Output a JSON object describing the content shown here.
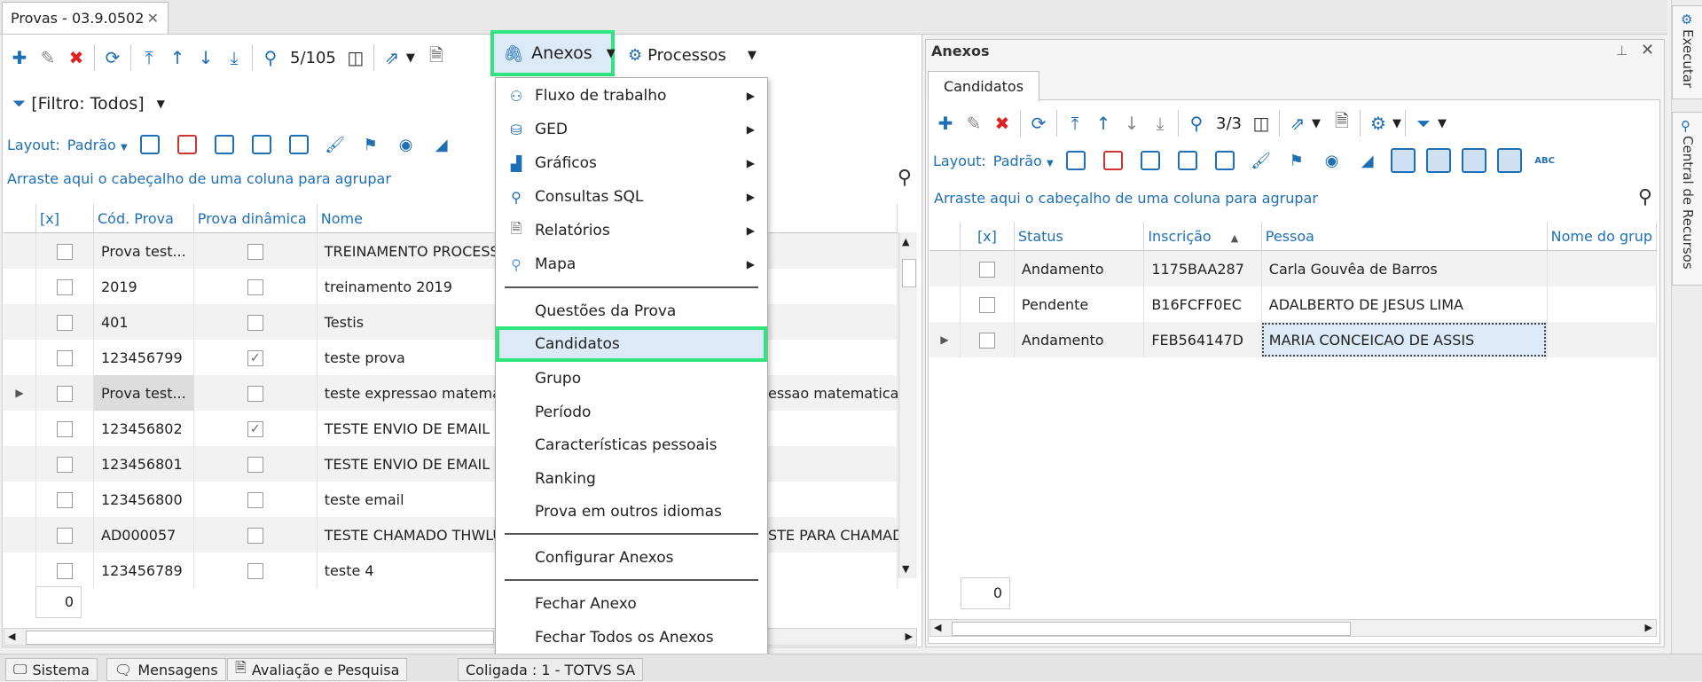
{
  "window": {
    "tab_title": "Provas - 03.9.0502",
    "tab_close": "✕"
  },
  "toolbar": {
    "counter": "5/105",
    "anexos_label": "Anexos",
    "processos_label": "Processos"
  },
  "filter": {
    "label": "[Filtro: Todos]"
  },
  "layoutbar": {
    "label": "Layout:",
    "value": "Padrão"
  },
  "grid": {
    "group_hint": "Arraste aqui o cabeçalho de uma coluna para agrupar",
    "columns": [
      "[x]",
      "Cód. Prova",
      "Prova dinâmica",
      "Nome"
    ],
    "rows": [
      {
        "cod": "Prova test...",
        "dyn": false,
        "nome": "TREINAMENTO PROCESSO",
        "extra": ""
      },
      {
        "cod": "2019",
        "dyn": false,
        "nome": "treinamento 2019",
        "extra": ""
      },
      {
        "cod": "401",
        "dyn": false,
        "nome": "Testis",
        "extra": ""
      },
      {
        "cod": "123456799",
        "dyn": true,
        "nome": "teste prova",
        "extra": ""
      },
      {
        "cod": "Prova test...",
        "dyn": false,
        "nome": "teste expressao matematica",
        "extra": "essao matematica"
      },
      {
        "cod": "123456802",
        "dyn": true,
        "nome": "TESTE ENVIO DE EMAIL WE",
        "extra": ""
      },
      {
        "cod": "123456801",
        "dyn": false,
        "nome": "TESTE ENVIO DE EMAIL WE",
        "extra": ""
      },
      {
        "cod": "123456800",
        "dyn": false,
        "nome": "teste email",
        "extra": ""
      },
      {
        "cod": "AD000057",
        "dyn": false,
        "nome": "TESTE CHAMADO THWLUD",
        "extra": "STE PARA CHAMADC"
      },
      {
        "cod": "123456789",
        "dyn": false,
        "nome": "teste 4",
        "extra": ""
      }
    ],
    "count": "0"
  },
  "menu": {
    "items": [
      {
        "label": "Fluxo de trabalho",
        "icon": "workflow-icon",
        "submenu": true
      },
      {
        "label": "GED",
        "icon": "ged-icon",
        "submenu": true
      },
      {
        "label": "Gráficos",
        "icon": "chart-icon",
        "submenu": true
      },
      {
        "label": "Consultas SQL",
        "icon": "search-icon",
        "submenu": true
      },
      {
        "label": "Relatórios",
        "icon": "report-icon",
        "submenu": true
      },
      {
        "label": "Mapa",
        "icon": "map-pin-icon",
        "submenu": true
      },
      {
        "label": "Questões da Prova"
      },
      {
        "label": "Candidatos",
        "highlighted": true
      },
      {
        "label": "Grupo"
      },
      {
        "label": "Período"
      },
      {
        "label": "Características pessoais"
      },
      {
        "label": "Ranking"
      },
      {
        "label": "Prova em outros idiomas"
      },
      {
        "label": "Configurar Anexos"
      },
      {
        "label": "Fechar Anexo"
      },
      {
        "label": "Fechar Todos os Anexos"
      }
    ]
  },
  "pane": {
    "title": "Anexos",
    "tab": "Candidatos",
    "counter": "3/3",
    "layout_label": "Layout:",
    "layout_value": "Padrão",
    "group_hint": "Arraste aqui o cabeçalho de uma coluna para agrupar",
    "columns": [
      "[x]",
      "Status",
      "Inscrição",
      "Pessoa",
      "Nome do grup"
    ],
    "rows": [
      {
        "status": "Andamento",
        "inscricao": "1175BAA287",
        "pessoa": "Carla Gouvêa de Barros"
      },
      {
        "status": "Pendente",
        "inscricao": "B16FCFF0EC",
        "pessoa": "ADALBERTO DE JESUS LIMA"
      },
      {
        "status": "Andamento",
        "inscricao": "FEB564147D",
        "pessoa": "MARIA CONCEICAO DE ASSIS"
      }
    ],
    "count": "0"
  },
  "sidebar": {
    "executar": "Executar",
    "central": "Central de Recursos"
  },
  "statusbar": {
    "sistema": "Sistema",
    "mensagens": "Mensagens",
    "avaliacao": "Avaliação e Pesquisa",
    "coligada": "Coligada : 1 - TOTVS SA"
  },
  "colors": {
    "accent": "#1f6fb6",
    "highlight": "#2ee57e",
    "danger": "#dd2222"
  }
}
